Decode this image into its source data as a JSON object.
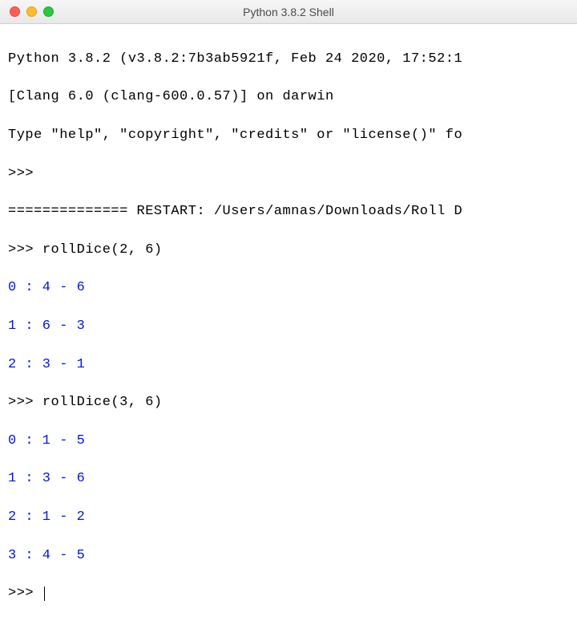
{
  "window": {
    "title": "Python 3.8.2 Shell"
  },
  "banner": {
    "line1": "Python 3.8.2 (v3.8.2:7b3ab5921f, Feb 24 2020, 17:52:1",
    "line2": "[Clang 6.0 (clang-600.0.57)] on darwin",
    "line3": "Type \"help\", \"copyright\", \"credits\" or \"license()\" fo"
  },
  "prompt": ">>>",
  "restart": {
    "sep": "==============",
    "label": " RESTART: ",
    "path": "/Users/amnas/Downloads/Roll D"
  },
  "calls": [
    {
      "input": "rollDice(2, 6)",
      "outputs": [
        "0 : 4 - 6",
        "1 : 6 - 3",
        "2 : 3 - 1"
      ]
    },
    {
      "input": "rollDice(3, 6)",
      "outputs": [
        "0 : 1 - 5",
        "1 : 3 - 6",
        "2 : 1 - 2",
        "3 : 4 - 5"
      ]
    }
  ]
}
